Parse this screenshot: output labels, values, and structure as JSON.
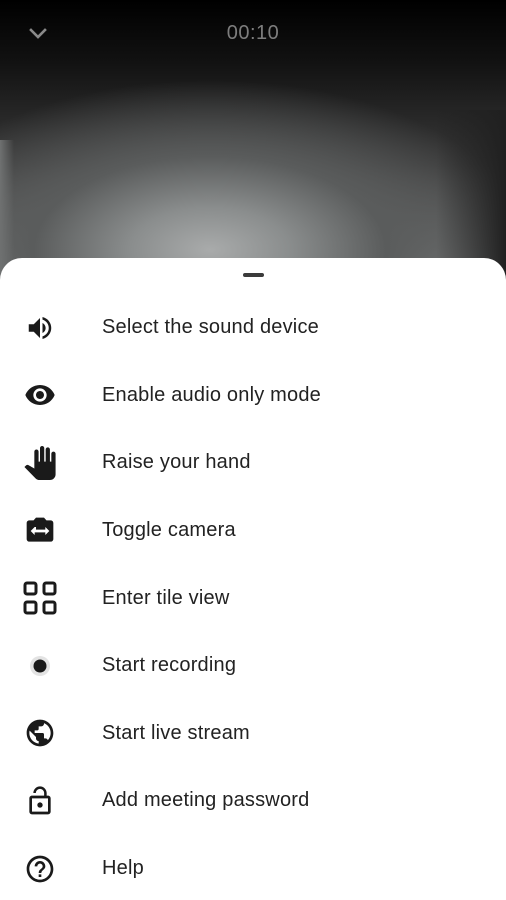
{
  "call": {
    "timer": "00:10",
    "collapse_icon": "chevron-down-icon"
  },
  "menu": {
    "items": [
      {
        "label": "Select the sound device",
        "icon": "volume-icon"
      },
      {
        "label": "Enable audio only mode",
        "icon": "eye-icon"
      },
      {
        "label": "Raise your hand",
        "icon": "hand-icon"
      },
      {
        "label": "Toggle camera",
        "icon": "switch-camera-icon"
      },
      {
        "label": "Enter tile view",
        "icon": "tile-view-icon"
      },
      {
        "label": "Start recording",
        "icon": "record-icon"
      },
      {
        "label": "Start live stream",
        "icon": "globe-icon"
      },
      {
        "label": "Add meeting password",
        "icon": "lock-icon"
      },
      {
        "label": "Help",
        "icon": "help-icon"
      }
    ]
  },
  "colors": {
    "sheet_background": "#ffffff",
    "label_text": "#222222",
    "icon": "#1a1a1a",
    "timer_text": "#7d7d7d"
  }
}
